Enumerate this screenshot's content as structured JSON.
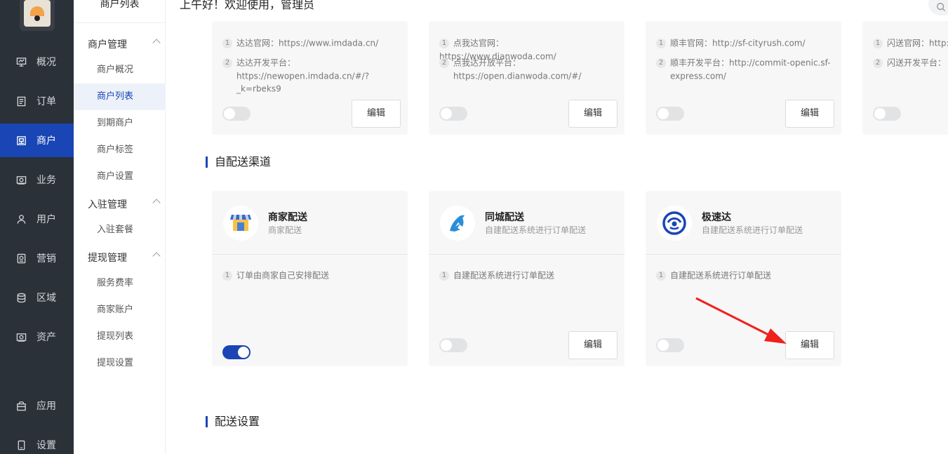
{
  "header": {
    "greeting": "上午好！欢迎使用，管理员"
  },
  "nav": {
    "items": [
      {
        "label": "概况",
        "icon": "chart-icon"
      },
      {
        "label": "订单",
        "icon": "document-icon"
      },
      {
        "label": "商户",
        "icon": "store-icon",
        "active": true
      },
      {
        "label": "业务",
        "icon": "business-icon"
      },
      {
        "label": "用户",
        "icon": "user-icon"
      },
      {
        "label": "营销",
        "icon": "marketing-icon"
      },
      {
        "label": "区域",
        "icon": "database-icon"
      },
      {
        "label": "资产",
        "icon": "asset-icon"
      },
      {
        "label": "应用",
        "icon": "bag-icon"
      },
      {
        "label": "设置",
        "icon": "phone-icon"
      }
    ]
  },
  "subnav": {
    "title": "商户列表",
    "groups": [
      {
        "label": "商户管理",
        "items": [
          "商户概况",
          "商户列表",
          "到期商户",
          "商户标签",
          "商户设置"
        ]
      },
      {
        "label": "入驻管理",
        "items": [
          "入驻套餐"
        ]
      },
      {
        "label": "提现管理",
        "items": [
          "服务费率",
          "商家账户",
          "提现列表",
          "提现设置"
        ]
      }
    ],
    "active": "商户列表"
  },
  "third_party_cards": [
    {
      "lines": [
        "达达官网：https://www.imdada.cn/",
        "达达开发平台：",
        "https://newopen.imdada.cn/#/?_k=rbeks9"
      ],
      "edit": "编辑"
    },
    {
      "lines": [
        "点我达官网：https://www.dianwoda.com/",
        "点我达开放平台：",
        "https://open.dianwoda.com/#/"
      ],
      "edit": "编辑"
    },
    {
      "lines": [
        "顺丰官网：http://sf-cityrush.com/",
        "顺丰开发平台：http://commit-openic.sf-",
        "express.com/"
      ],
      "edit": "编辑"
    },
    {
      "lines": [
        "闪送官网：http:",
        "闪送开发平台："
      ]
    }
  ],
  "self_delivery": {
    "title": "自配送渠道",
    "cards": [
      {
        "name": "商家配送",
        "desc": "商家配送",
        "item": "订单由商家自己安排配送",
        "enabled": true
      },
      {
        "name": "同城配送",
        "desc": "自建配送系统进行订单配送",
        "item": "自建配送系统进行订单配送",
        "enabled": false,
        "edit": "编辑"
      },
      {
        "name": "极速达",
        "desc": "自建配送系统进行订单配送",
        "item": "自建配送系统进行订单配送",
        "enabled": false,
        "edit": "编辑"
      }
    ]
  },
  "delivery_settings": {
    "title": "配送设置"
  },
  "colors": {
    "accent": "#1a45b4",
    "nav_bg": "#2b3139",
    "card_bg": "#f7f7f8",
    "arrow": "#f0211a"
  }
}
